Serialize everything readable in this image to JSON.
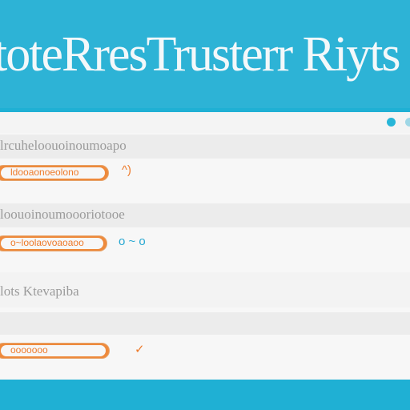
{
  "banner": {
    "title": "toteRresTrusterr Riyts"
  },
  "panel": {
    "rows": [
      {
        "header": "lrcuheloouoinoumoapo",
        "field": "ldooaonoeolono",
        "indicator": "^)"
      },
      {
        "header": "loouoinoumoooriotooe",
        "field": "o~loolaovoaoaoo",
        "indicator": "o ~ o"
      },
      {
        "header": "lots  Ktevapiba",
        "field": "ooooooo",
        "indicator": "✓"
      }
    ]
  },
  "colors": {
    "accent": "#ee8a3c",
    "brand": "#2db3d6",
    "panel_bg": "#f7f7f7",
    "header_bg": "#ececec",
    "header_text": "#9b9b9b"
  }
}
